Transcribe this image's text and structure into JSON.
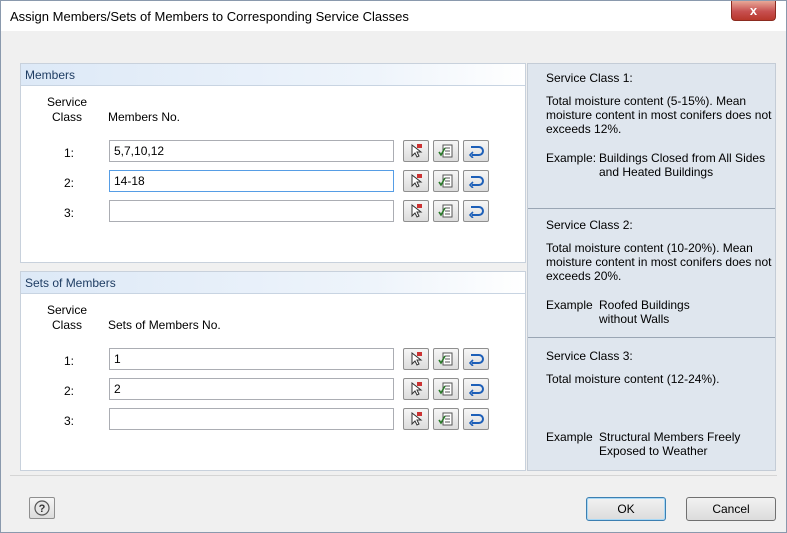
{
  "window": {
    "title": "Assign Members/Sets of Members to Corresponding Service Classes",
    "close_glyph": "x"
  },
  "members": {
    "header": "Members",
    "col_service": "Service\nClass",
    "col_no": "Members No.",
    "rows": [
      {
        "label": "1:",
        "value": "5,7,10,12"
      },
      {
        "label": "2:",
        "value": "14-18"
      },
      {
        "label": "3:",
        "value": ""
      }
    ]
  },
  "sets": {
    "header": "Sets of Members",
    "col_service": "Service\nClass",
    "col_no": "Sets of Members No.",
    "rows": [
      {
        "label": "1:",
        "value": "1"
      },
      {
        "label": "2:",
        "value": "2"
      },
      {
        "label": "3:",
        "value": ""
      }
    ]
  },
  "info": {
    "sc1": {
      "title": "Service Class 1:",
      "text": "Total moisture content (5-15%). Mean moisture content in most conifers does not exceeds 12%.",
      "example_label": "Example:",
      "example_text": "Buildings Closed from All Sides and Heated Buildings"
    },
    "sc2": {
      "title": "Service Class 2:",
      "text": "Total moisture content (10-20%). Mean moisture content in most conifers does not exceeds 20%.",
      "example_label": "Example",
      "example_text": "Roofed Buildings without Walls"
    },
    "sc3": {
      "title": "Service Class 3:",
      "text": "Total moisture content (12-24%).",
      "example_label": "Example",
      "example_text": "Structural Members Freely Exposed to Weather"
    }
  },
  "buttons": {
    "ok": "OK",
    "cancel": "Cancel"
  },
  "icons": {
    "pick": "pick-member-cursor-icon",
    "select_list": "select-list-icon",
    "clear": "clear-selection-icon",
    "help": "help-icon"
  }
}
